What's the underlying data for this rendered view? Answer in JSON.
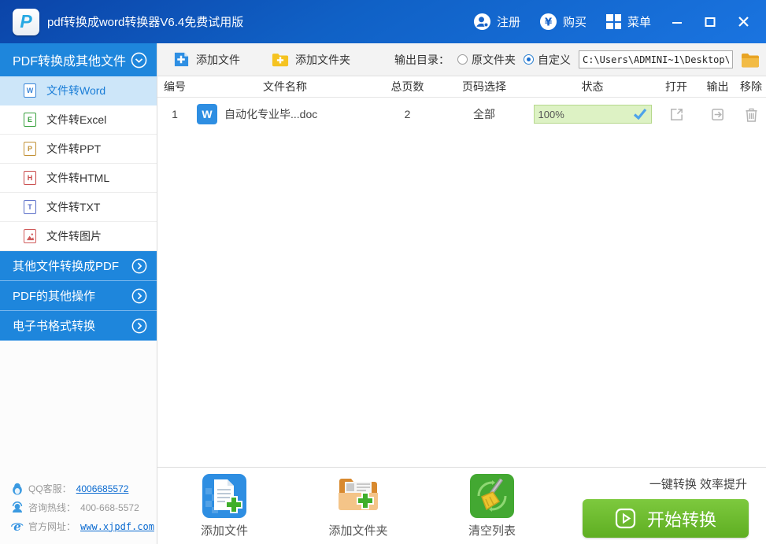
{
  "titlebar": {
    "title": "pdf转换成word转换器V6.4免费试用版",
    "register": "注册",
    "buy": "购买",
    "menu": "菜单"
  },
  "sidebar": {
    "header": {
      "label": "PDF转换成其他文件"
    },
    "items": [
      {
        "label": "文件转Word",
        "letter": "W",
        "selected": true
      },
      {
        "label": "文件转Excel",
        "letter": "E"
      },
      {
        "label": "文件转PPT",
        "letter": "P"
      },
      {
        "label": "文件转HTML",
        "letter": "H"
      },
      {
        "label": "文件转TXT",
        "letter": "T"
      },
      {
        "label": "文件转图片",
        "letter": ""
      }
    ],
    "collapsed_sections": [
      {
        "label": "其他文件转换成PDF"
      },
      {
        "label": "PDF的其他操作"
      },
      {
        "label": "电子书格式转换"
      }
    ],
    "contact": {
      "qq_label": "QQ客服：",
      "qq_value": "4006685572",
      "hotline_label": "咨询热线：",
      "hotline_value": "400-668-5572",
      "site_label": "官方网址：",
      "site_value": "www.xjpdf.com"
    }
  },
  "toolbar": {
    "add_file": "添加文件",
    "add_folder": "添加文件夹",
    "output_dir_label": "输出目录：",
    "radio_source": "原文件夹",
    "radio_custom": "自定义",
    "path": "C:\\Users\\ADMINI~1\\Desktop\\"
  },
  "table": {
    "headers": [
      "编号",
      "文件名称",
      "总页数",
      "页码选择",
      "状态",
      "打开",
      "输出",
      "移除"
    ],
    "rows": [
      {
        "no": "1",
        "name": "自动化专业毕...doc",
        "pages": "2",
        "range": "全部",
        "progress": "100%",
        "done": true
      }
    ]
  },
  "footer": {
    "actions": [
      {
        "label": "添加文件"
      },
      {
        "label": "添加文件夹"
      },
      {
        "label": "清空列表"
      }
    ],
    "slogan": "一键转换 效率提升",
    "start": "开始转换"
  },
  "colors": {
    "titlebar_blue": "#1061c6",
    "sidebar_blue": "#1e86dc",
    "selected_bg": "#cde6f9",
    "accent_blue": "#1a7dd7",
    "progress_bg": "#ddf2c4",
    "progress_border": "#b6d88c",
    "start_green": "#6cbd2d",
    "folder_yellow": "#f5c321"
  }
}
